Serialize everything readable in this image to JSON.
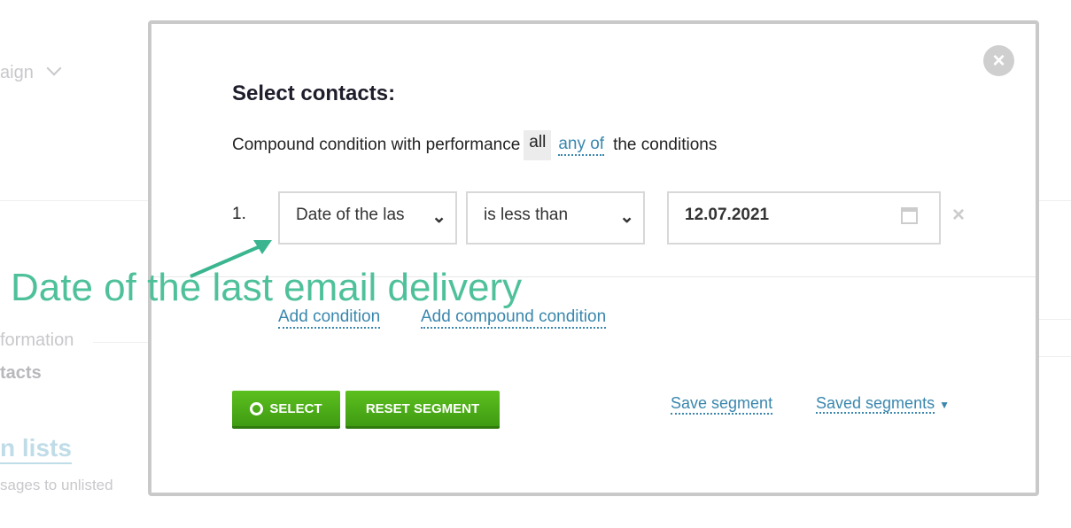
{
  "background": {
    "campaign": "aign",
    "information": "formation",
    "contacts": "tacts",
    "lists": "n lists",
    "unlisted": "sages to unlisted"
  },
  "modal": {
    "title": "Select contacts:",
    "condition_prefix": "Compound condition with performance",
    "mode_all": "all",
    "mode_any": "any of",
    "condition_suffix": "the conditions",
    "rows": [
      {
        "index": "1.",
        "field": "Date of the las",
        "operator": "is less than",
        "value": "12.07.2021"
      }
    ],
    "add_condition": "Add condition",
    "add_compound_condition": "Add compound condition",
    "select_button": "SELECT",
    "reset_button": "RESET SEGMENT",
    "save_segment": "Save segment",
    "saved_segments": "Saved segments"
  },
  "annotation": "Date of the last email delivery",
  "colors": {
    "accent_link": "#3a87ad",
    "button_green": "#4cae1c",
    "annotation": "#4fc19a"
  }
}
